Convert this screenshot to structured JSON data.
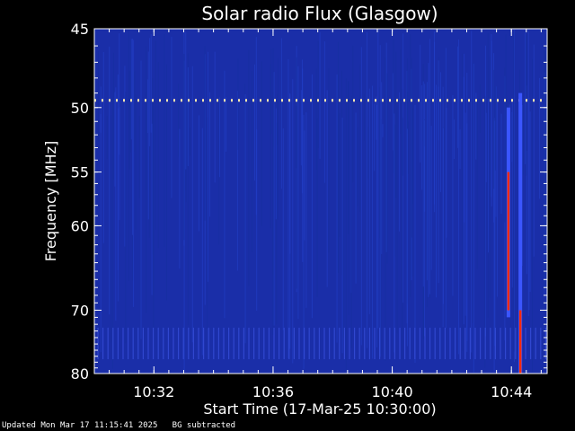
{
  "chart_data": {
    "type": "heatmap",
    "title": "Solar radio Flux (Glasgow)",
    "xlabel": "Start Time (17-Mar-25 10:30:00)",
    "ylabel": "Frequency [MHz]",
    "x_unit": "minutes after 10:30:00",
    "xlim": [
      0,
      15.2
    ],
    "ylim": [
      45,
      80
    ],
    "yscale": "reciprocal",
    "x_ticks": [
      {
        "value": 2,
        "label": "10:32"
      },
      {
        "value": 6,
        "label": "10:36"
      },
      {
        "value": 10,
        "label": "10:40"
      },
      {
        "value": 14,
        "label": "10:44"
      }
    ],
    "y_ticks": [
      {
        "value": 45,
        "label": "45"
      },
      {
        "value": 50,
        "label": "50"
      },
      {
        "value": 55,
        "label": "55"
      },
      {
        "value": 60,
        "label": "60"
      },
      {
        "value": 70,
        "label": "70"
      },
      {
        "value": 80,
        "label": "80"
      }
    ],
    "background_color": "#1a2ea8",
    "colors": {
      "low": "#1a2ea8",
      "mid": "#3b56ff",
      "high": "#ff2a00",
      "peak": "#ffe6a0"
    },
    "features": [
      {
        "kind": "interference-line",
        "frequency": 49.5,
        "x_range": [
          0,
          15.2
        ]
      },
      {
        "kind": "burst",
        "x": 13.9,
        "freq_range": [
          50,
          71
        ],
        "peak_freq_range": [
          55,
          70
        ]
      },
      {
        "kind": "burst",
        "x": 14.3,
        "freq_range": [
          49,
          80
        ],
        "peak_freq_range": [
          70,
          80
        ]
      }
    ]
  },
  "footer": {
    "updated": "Updated Mon Mar 17 11:15:41 2025",
    "note": "BG subtracted"
  }
}
